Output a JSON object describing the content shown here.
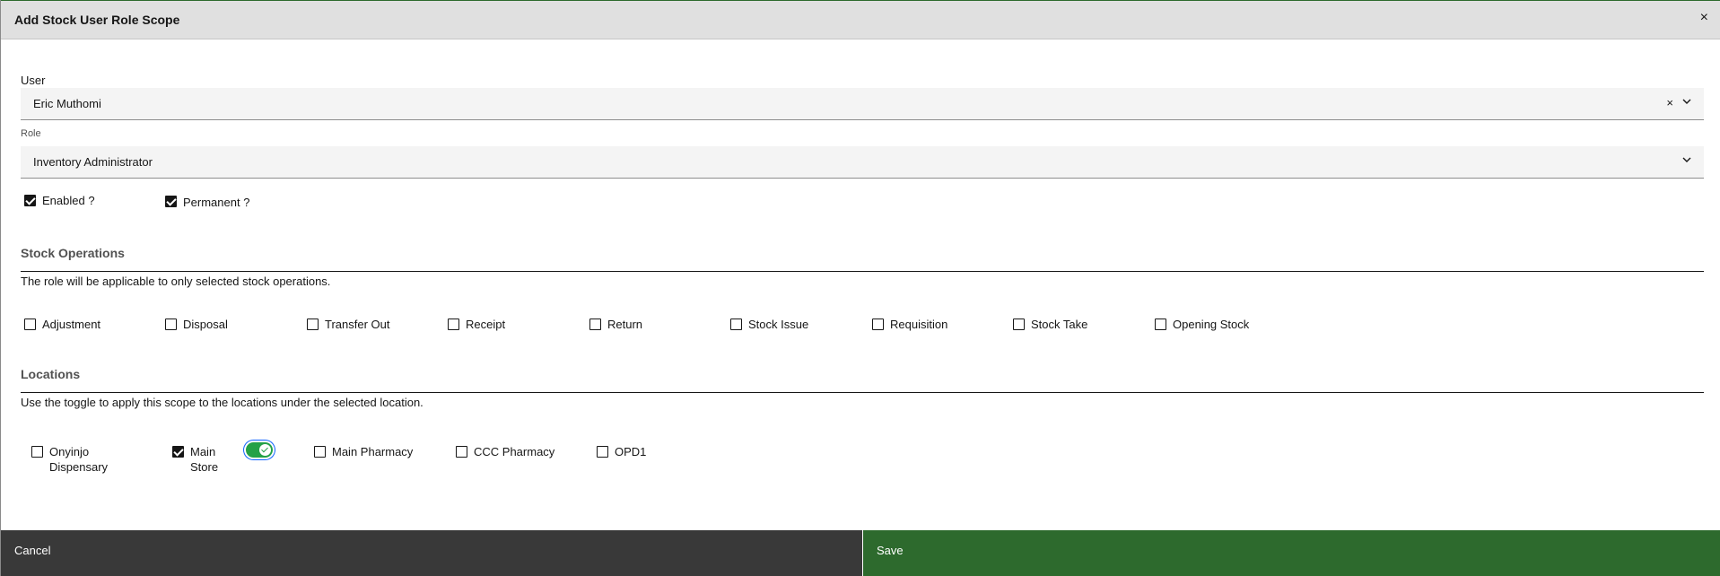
{
  "modal": {
    "title": "Add Stock User Role Scope",
    "close_label": "×"
  },
  "user": {
    "label": "User",
    "value": "Eric Muthomi",
    "clear": "×"
  },
  "role": {
    "label": "Role",
    "value": "Inventory Administrator"
  },
  "flags": [
    {
      "label": "Enabled ?",
      "checked": true
    },
    {
      "label": "Permanent ?",
      "checked": true
    }
  ],
  "stock_operations": {
    "title": "Stock Operations",
    "description": "The role will be applicable to only selected stock operations.",
    "items": [
      {
        "label": "Adjustment",
        "checked": false
      },
      {
        "label": "Disposal",
        "checked": false
      },
      {
        "label": "Transfer Out",
        "checked": false
      },
      {
        "label": "Receipt",
        "checked": false
      },
      {
        "label": "Return",
        "checked": false
      },
      {
        "label": "Stock Issue",
        "checked": false
      },
      {
        "label": "Requisition",
        "checked": false
      },
      {
        "label": "Stock Take",
        "checked": false
      },
      {
        "label": "Opening Stock",
        "checked": false
      }
    ]
  },
  "locations": {
    "title": "Locations",
    "description": "Use the toggle to apply this scope to the locations under the selected location.",
    "items": [
      {
        "label_line1": "Onyinjo",
        "label_line2": "Dispensary",
        "checked": false
      },
      {
        "label_line1": "Main",
        "label_line2": "Store",
        "checked": true,
        "toggle_on": true
      },
      {
        "label_line1": "Main Pharmacy",
        "label_line2": "",
        "checked": false
      },
      {
        "label_line1": "CCC Pharmacy",
        "label_line2": "",
        "checked": false
      },
      {
        "label_line1": "OPD1",
        "label_line2": "",
        "checked": false
      }
    ]
  },
  "footer": {
    "cancel_label": "Cancel",
    "save_label": "Save"
  },
  "colors": {
    "save": "#2d6a2d",
    "cancel": "#393939",
    "toggle_on": "#24a148",
    "focus": "#0f62fe"
  }
}
